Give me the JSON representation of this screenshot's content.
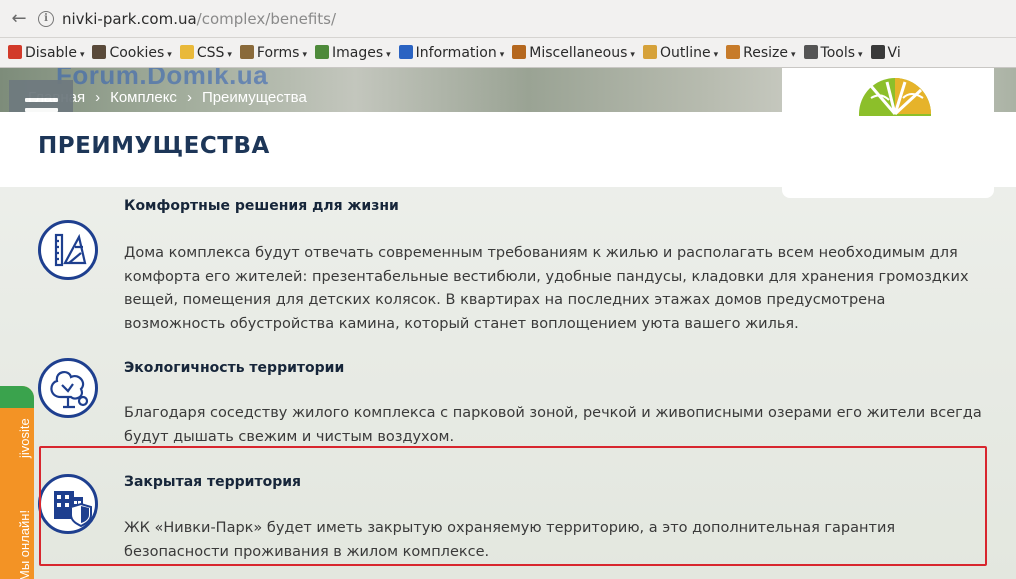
{
  "browser": {
    "url_host": "nivki-park.com.ua",
    "url_path": "/complex/benefits/"
  },
  "devbar": {
    "items": [
      {
        "label": "Disable",
        "icon": "disable-icon",
        "color": "#d23a2a"
      },
      {
        "label": "Cookies",
        "icon": "cookies-icon",
        "color": "#5a4a3a"
      },
      {
        "label": "CSS",
        "icon": "css-icon",
        "color": "#e9b93a"
      },
      {
        "label": "Forms",
        "icon": "forms-icon",
        "color": "#8a6a3a"
      },
      {
        "label": "Images",
        "icon": "images-icon",
        "color": "#4e8a3a"
      },
      {
        "label": "Information",
        "icon": "information-icon",
        "color": "#2b63c2"
      },
      {
        "label": "Miscellaneous",
        "icon": "miscellaneous-icon",
        "color": "#b5681f"
      },
      {
        "label": "Outline",
        "icon": "outline-icon",
        "color": "#d6a23a"
      },
      {
        "label": "Resize",
        "icon": "resize-icon",
        "color": "#c77b2a"
      },
      {
        "label": "Tools",
        "icon": "tools-icon",
        "color": "#555555"
      },
      {
        "label": "Vi",
        "icon": "view-icon",
        "color": "#3a3a3a"
      }
    ]
  },
  "watermark": "Forum.Domik.ua",
  "breadcrumb": {
    "home": "Главная",
    "section": "Комплекс",
    "current": "Преимущества",
    "separator": "›"
  },
  "page_title": "ПРЕИМУЩЕСТВА",
  "features": [
    {
      "title": "Комфортные решения для жизни",
      "text": "Дома комплекса будут отвечать современным требованиям к жилью и располагать всем необходимым для комфорта его жителей: презентабельные вестибюли, удобные пандусы, кладовки для хранения громоздких вещей, помещения для детских колясок. В квартирах на последних этажах домов предусмотрена возможность обустройства камина, который станет воплощением уюта вашего жилья.",
      "icon": "ruler-compass-icon"
    },
    {
      "title": "Экологичность территории",
      "text": "Благодаря соседству жилого комплекса с парковой зоной, речкой и живописными озерами его жители всегда будут дышать свежим и чистым воздухом.",
      "icon": "tree-icon"
    },
    {
      "title": "Закрытая территория",
      "text": "ЖК «Нивки-Парк» будет иметь закрытую охраняемую территорию, а это дополнительная гарантия безопасности проживания в жилом комплексе.",
      "icon": "building-shield-icon"
    }
  ],
  "jivosite": {
    "brand": "jivosite",
    "status": "Мы онлайн!"
  },
  "colors": {
    "title": "#1d3658",
    "icon_ring": "#1e3f8f",
    "highlight": "#d8262e",
    "jivo_orange": "#f39325",
    "jivo_green": "#3aa34d"
  }
}
